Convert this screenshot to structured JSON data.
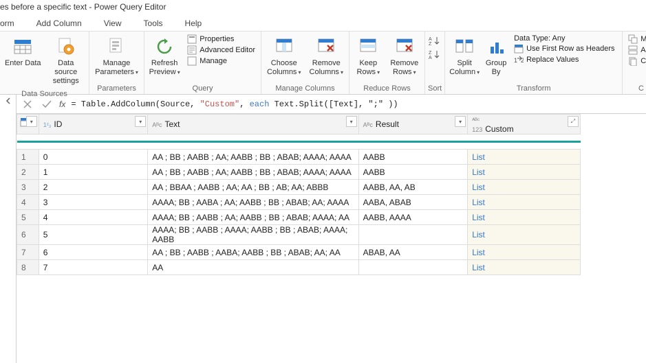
{
  "window": {
    "title": "es before a specific text - Power Query Editor"
  },
  "menus": [
    "orm",
    "Add Column",
    "View",
    "Tools",
    "Help"
  ],
  "ribbon": {
    "enter_data": "Enter\nData",
    "data_source_settings": "Data source\nsettings",
    "data_sources_group": "Data Sources",
    "manage_parameters": "Manage\nParameters",
    "parameters_group": "Parameters",
    "refresh_preview": "Refresh\nPreview",
    "properties": "Properties",
    "advanced_editor": "Advanced Editor",
    "manage": "Manage",
    "query_group": "Query",
    "choose_columns": "Choose\nColumns",
    "remove_columns": "Remove\nColumns",
    "manage_columns_group": "Manage Columns",
    "keep_rows": "Keep\nRows",
    "remove_rows": "Remove\nRows",
    "reduce_rows_group": "Reduce Rows",
    "sort_group": "Sort",
    "split_column": "Split\nColumn",
    "group_by": "Group\nBy",
    "data_type": "Data Type: Any",
    "first_row_headers": "Use First Row as Headers",
    "replace_values": "Replace Values",
    "transform_group": "Transform",
    "mer": "Mer",
    "app": "App",
    "com": "Cor"
  },
  "formula": {
    "prefix": "= Table.AddColumn(Source, ",
    "str": "\"Custom\"",
    "mid": ", ",
    "each": "each",
    "rest": " Text.Split([Text], \";\" ))"
  },
  "columns": {
    "id": "ID",
    "text": "Text",
    "result": "Result",
    "custom": "Custom"
  },
  "rows": [
    {
      "n": "1",
      "id": "0",
      "text": "AA ; BB ; AABB ; AA; AABB ; BB ; ABAB; AAAA; AAAA",
      "result": "AABB",
      "custom": "List"
    },
    {
      "n": "2",
      "id": "1",
      "text": "AA ; BB ; AABB ; AA; AABB ; BB ; ABAB; AAAA; AAAA",
      "result": "AABB",
      "custom": "List"
    },
    {
      "n": "3",
      "id": "2",
      "text": "AA ; BBAA ; AABB ; AA; AA ; BB ; AB; AA; ABBB",
      "result": "AABB, AA, AB",
      "custom": "List"
    },
    {
      "n": "4",
      "id": "3",
      "text": "AAAA; BB ; AABA ; AA; AABB ; BB ; ABAB; AA; AAAA",
      "result": "AABA, ABAB",
      "custom": "List"
    },
    {
      "n": "5",
      "id": "4",
      "text": "AAAA; BB ; AABB ; AA; AABB ; BB ; ABAB; AAAA; AA",
      "result": "AABB, AAAA",
      "custom": "List"
    },
    {
      "n": "6",
      "id": "5",
      "text": "AAAA; BB ; AABB ; AAAA; AABB ; BB ; ABAB; AAAA; AABB",
      "result": "",
      "custom": "List"
    },
    {
      "n": "7",
      "id": "6",
      "text": "AA ; BB ; AABB ; AABA; AABB ; BB ; ABAB; AA; AA",
      "result": "ABAB, AA",
      "custom": "List"
    },
    {
      "n": "8",
      "id": "7",
      "text": "AA",
      "result": "",
      "custom": "List"
    }
  ]
}
